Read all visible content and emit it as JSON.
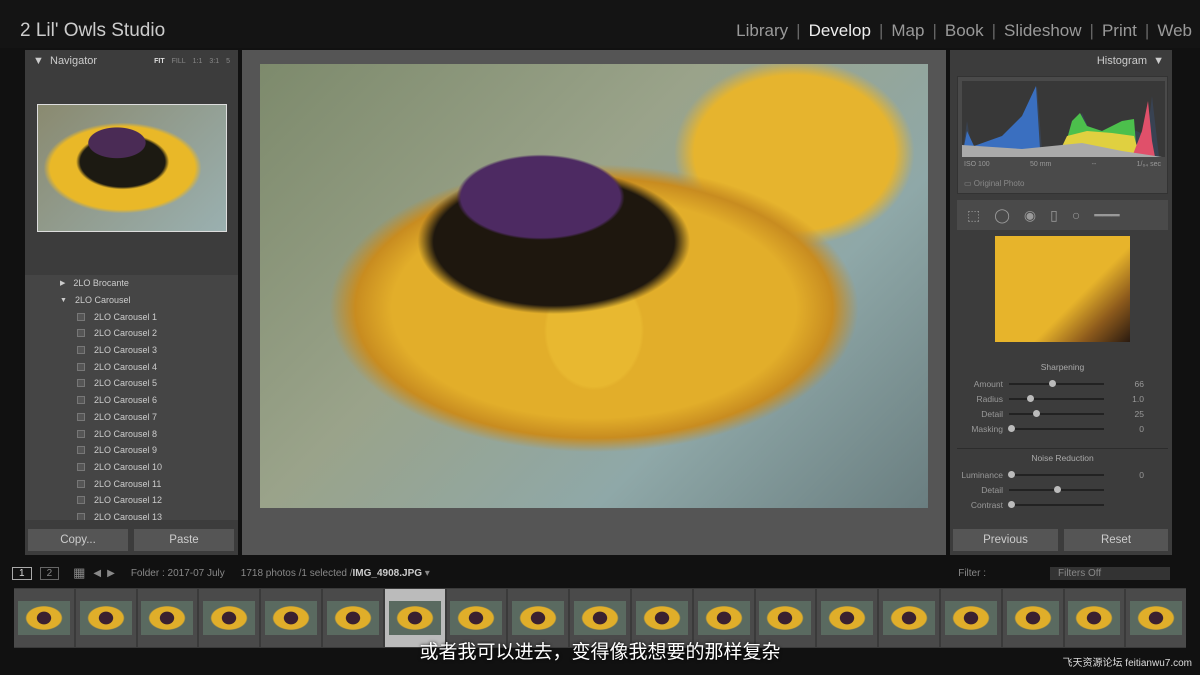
{
  "header": {
    "brand": "2 Lil' Owls Studio",
    "modules": [
      "Library",
      "Develop",
      "Map",
      "Book",
      "Slideshow",
      "Print",
      "Web"
    ],
    "active": "Develop"
  },
  "navigator": {
    "title": "Navigator",
    "zoom": [
      "FIT",
      "FILL",
      "1:1",
      "3:1",
      "5"
    ]
  },
  "collections": {
    "items": [
      "2LO Brocante",
      "2LO Carousel",
      "2LO Carousel 1",
      "2LO Carousel 2",
      "2LO Carousel 3",
      "2LO Carousel 4",
      "2LO Carousel 5",
      "2LO Carousel 6",
      "2LO Carousel 7",
      "2LO Carousel 8",
      "2LO Carousel 9",
      "2LO Carousel 10",
      "2LO Carousel 11",
      "2LO Carousel 12",
      "2LO Carousel 13"
    ]
  },
  "left_buttons": {
    "copy": "Copy...",
    "paste": "Paste"
  },
  "histogram": {
    "title": "Histogram",
    "iso": "ISO 100",
    "focal": "50 mm",
    "aperture": "--",
    "shutter": "1/₆₄ sec",
    "original_photo": "Original Photo"
  },
  "sharpening": {
    "title": "Sharpening",
    "rows": [
      {
        "label": "Amount",
        "value": "66",
        "pos": 0.45
      },
      {
        "label": "Radius",
        "value": "1.0",
        "pos": 0.22
      },
      {
        "label": "Detail",
        "value": "25",
        "pos": 0.28
      },
      {
        "label": "Masking",
        "value": "0",
        "pos": 0.02
      }
    ]
  },
  "noise": {
    "title": "Noise Reduction",
    "rows": [
      {
        "label": "Luminance",
        "value": "0",
        "pos": 0.02
      },
      {
        "label": "Detail",
        "value": "",
        "pos": 0.5
      },
      {
        "label": "Contrast",
        "value": "",
        "pos": 0.02
      }
    ]
  },
  "right_buttons": {
    "previous": "Previous",
    "reset": "Reset"
  },
  "filmbar": {
    "view1": "1",
    "view2": "2",
    "folder": "Folder : 2017-07 July",
    "count": "1718 photos /1 selected /",
    "filename": "IMG_4908.JPG",
    "filter_label": "Filter :",
    "filter_value": "Filters Off"
  },
  "subtitle": "或者我可以进去，变得像我想要的那样复杂",
  "watermark": "飞天资源论坛 feitianwu7.com"
}
